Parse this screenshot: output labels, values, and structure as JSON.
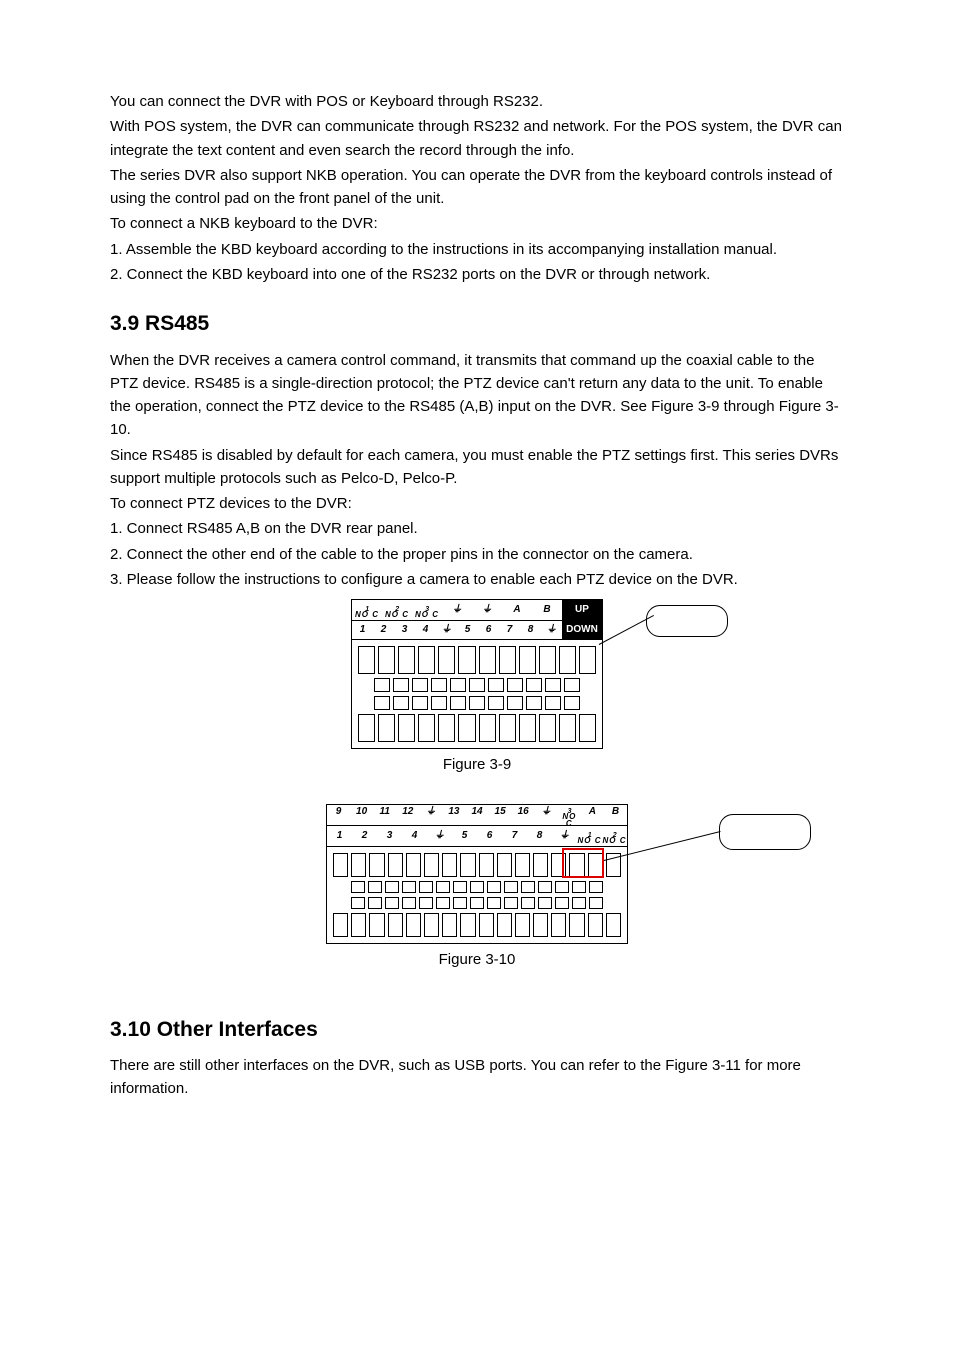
{
  "intro": {
    "p1": "You can connect the DVR with POS or Keyboard through RS232.",
    "p2": "With POS system, the DVR can communicate through RS232 and network. For the POS system, the DVR can integrate the text content and even search the record through the info.",
    "p3": "The series DVR also support NKB operation. You can operate the DVR from the keyboard controls instead of using the control pad on the front panel of the unit.",
    "p4": "To connect a NKB keyboard to the DVR:",
    "p5": "1. Assemble the KBD keyboard according to the instructions in its accompanying installation manual.",
    "p6": "2. Connect the KBD keyboard into one of the RS232 ports on the DVR or through network."
  },
  "sec39": {
    "heading": "3.9  RS485",
    "p1": "When the DVR receives a camera control command, it transmits that command up the coaxial cable to the PTZ device. RS485 is a single-direction protocol; the PTZ device can't return any data to the unit. To enable the operation, connect the PTZ device to the RS485 (A,B) input on the DVR. See Figure 3-9 through Figure 3-10.",
    "p2": "Since RS485 is disabled by default for each camera, you must enable the PTZ settings first. This series DVRs support multiple protocols such as Pelco-D, Pelco-P.",
    "p3": "To connect PTZ devices to the DVR:",
    "p4": "1. Connect RS485 A,B  on the DVR rear panel.",
    "p5": "2. Connect the other end of the cable to the proper pins in the connector on the camera.",
    "p6": "3. Please follow the instructions to configure a camera to enable each PTZ device on the DVR."
  },
  "fig39": {
    "caption": "Figure 3-9",
    "top_row": [
      "NO C",
      "NO C",
      "NO C",
      "⏚",
      "⏚",
      "A",
      "B"
    ],
    "top_overline": [
      "1",
      "2",
      "3"
    ],
    "bottom_row": [
      "1",
      "2",
      "3",
      "4",
      "⏚",
      "5",
      "6",
      "7",
      "8",
      "⏚"
    ],
    "up": "UP",
    "down": "DOWN"
  },
  "fig310": {
    "caption": "Figure 3-10",
    "top_row": [
      "9",
      "10",
      "11",
      "12",
      "⏚",
      "13",
      "14",
      "15",
      "16",
      "⏚",
      "NO C",
      "A",
      "B"
    ],
    "top_overline_last": "3",
    "bottom_row": [
      "1",
      "2",
      "3",
      "4",
      "⏚",
      "5",
      "6",
      "7",
      "8",
      "⏚",
      "NO C",
      "NO C"
    ],
    "bottom_overline": [
      "1",
      "2"
    ]
  },
  "sec310": {
    "heading": "3.10 Other Interfaces",
    "p1": "There are still other interfaces on the DVR, such as USB ports.  You can refer to the Figure 3-11 for more information."
  }
}
